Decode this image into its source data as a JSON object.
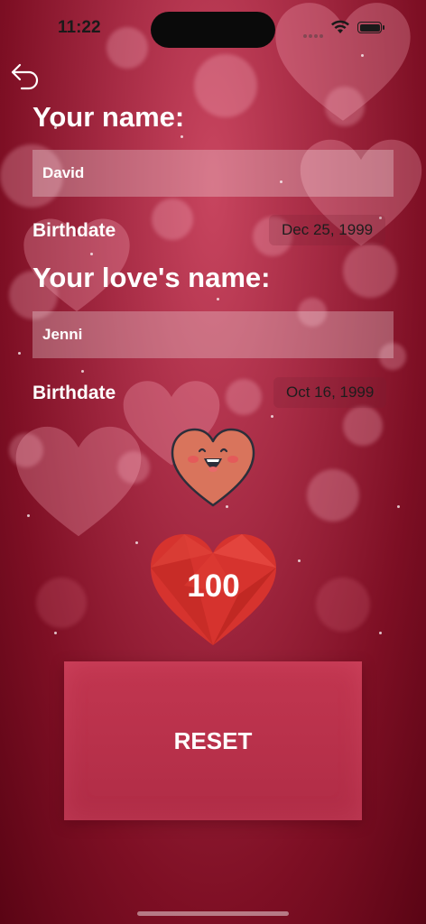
{
  "status_bar": {
    "time": "11:22"
  },
  "form": {
    "your_name_heading": "Your name:",
    "your_name_value": "David",
    "your_birthdate_label": "Birthdate",
    "your_birthdate_value": "Dec 25, 1999",
    "love_name_heading": "Your love's name:",
    "love_name_value": "Jenni",
    "love_birthdate_label": "Birthdate",
    "love_birthdate_value": "Oct 16, 1999"
  },
  "result": {
    "score": "100",
    "mood_icon": "happy-heart-icon"
  },
  "actions": {
    "reset_label": "RESET"
  },
  "colors": {
    "background": "#a52a43",
    "reset_button": "#b8304a",
    "score_heart": "#d6332e"
  }
}
